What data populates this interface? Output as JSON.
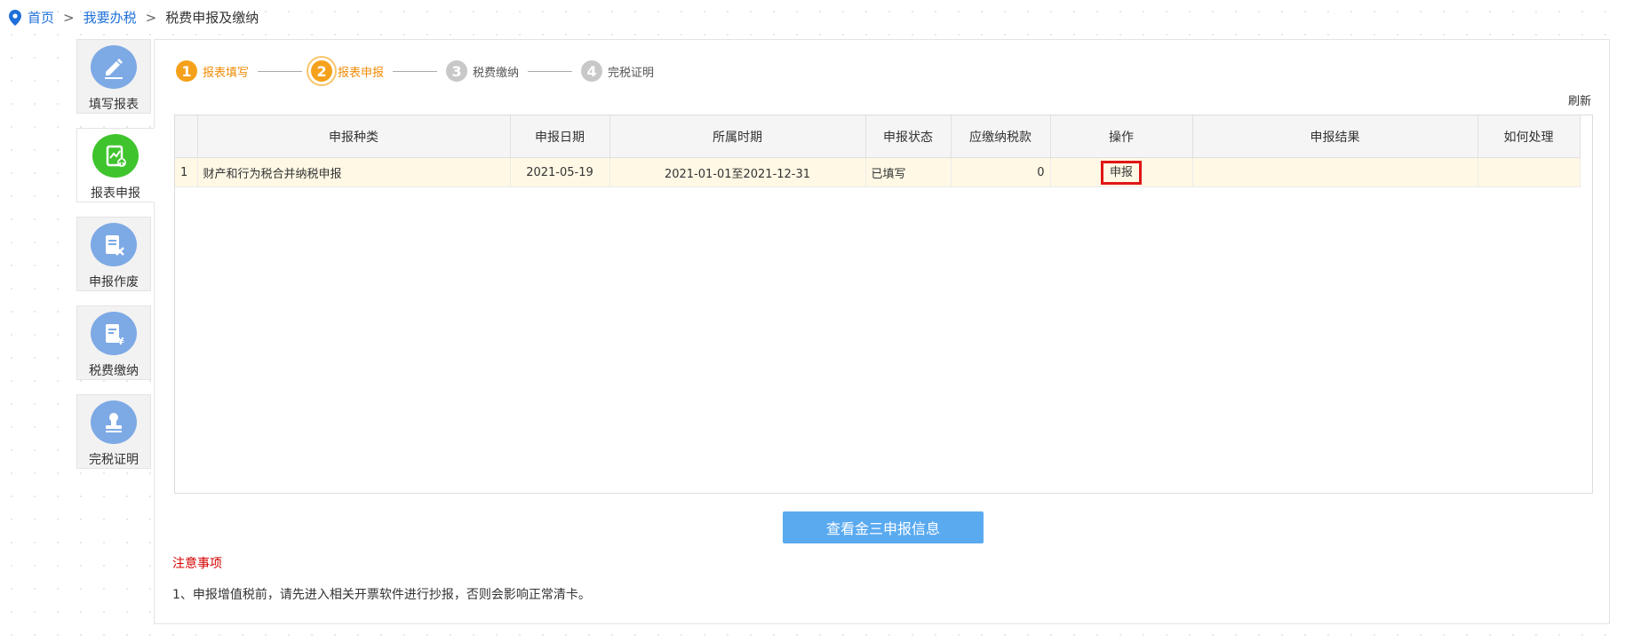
{
  "breadcrumb": {
    "home": "首页",
    "section": "我要办税",
    "current": "税费申报及缴纳",
    "separator": ">"
  },
  "sidebar": {
    "items": [
      {
        "label": "填写报表",
        "icon": "pencil-icon",
        "active": false
      },
      {
        "label": "报表申报",
        "icon": "report-chart-icon",
        "active": true
      },
      {
        "label": "申报作废",
        "icon": "void-document-icon",
        "active": false
      },
      {
        "label": "税费缴纳",
        "icon": "tax-payment-icon",
        "active": false
      },
      {
        "label": "完税证明",
        "icon": "stamp-icon",
        "active": false
      }
    ]
  },
  "steps": [
    {
      "num": "1",
      "label": "报表填写",
      "state": "done"
    },
    {
      "num": "2",
      "label": "报表申报",
      "state": "current"
    },
    {
      "num": "3",
      "label": "税费缴纳",
      "state": "pending"
    },
    {
      "num": "4",
      "label": "完税证明",
      "state": "pending"
    }
  ],
  "refresh_label": "刷新",
  "table": {
    "headers": [
      "",
      "申报种类",
      "申报日期",
      "所属时期",
      "申报状态",
      "应缴纳税款",
      "操作",
      "申报结果",
      "如何处理"
    ],
    "rows": [
      {
        "index": "1",
        "type": "财产和行为税合并纳税申报",
        "date": "2021-05-19",
        "period": "2021-01-01至2021-12-31",
        "status": "已填写",
        "tax": "0",
        "action": "申报",
        "result": "",
        "handling": ""
      }
    ]
  },
  "query_button": "查看金三申报信息",
  "notice": {
    "title": "注意事项",
    "text": "1、申报增值税前，请先进入相关开票软件进行抄报，否则会影响正常清卡。"
  },
  "colors": {
    "link": "#1e6fd9",
    "step_active": "#f5a11b",
    "step_inactive": "#c8c8c8",
    "sidebar_icon": "#7da9e5",
    "sidebar_active_icon": "#3fc42d",
    "row_highlight": "#fff8e5",
    "action_highlight": "#e01616",
    "primary_button": "#5aaaf0",
    "notice_title": "#d40000"
  }
}
